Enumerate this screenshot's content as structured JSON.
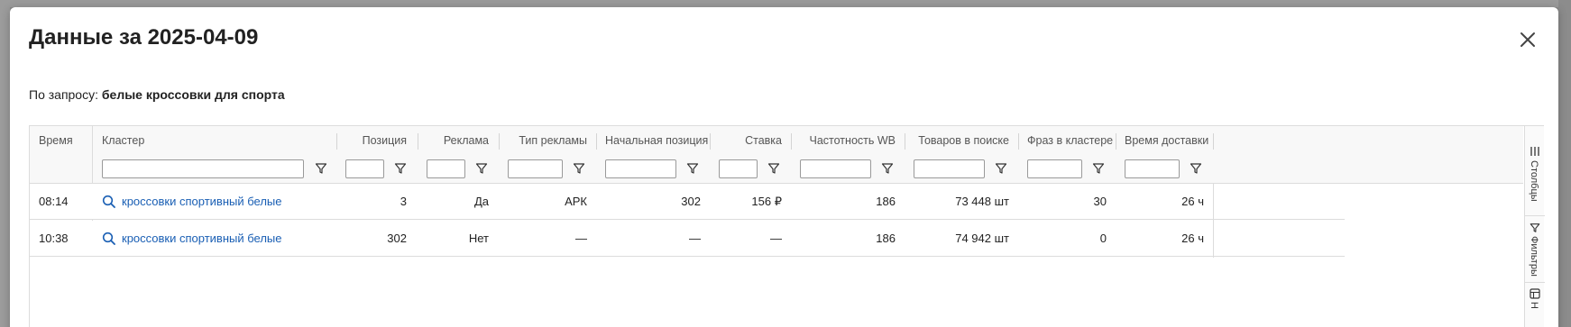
{
  "modal": {
    "title": "Данные за 2025-04-09",
    "query_label": "По запросу:",
    "query_value": "белые кроссовки для спорта"
  },
  "table": {
    "columns": [
      "Время",
      "Кластер",
      "Позиция",
      "Реклама",
      "Тип рекламы",
      "Начальная позиция",
      "Ставка",
      "Частотность WB",
      "Товаров в поиске",
      "Фраз в кластере",
      "Время доставки"
    ],
    "rows": [
      {
        "time": "08:14",
        "cluster": "кроссовки спортивный белые",
        "position": "3",
        "ad": "Да",
        "ad_type": "АРК",
        "start_position": "302",
        "bid": "156 ₽",
        "frequency": "186",
        "items_in_search": "73 448 шт",
        "phrases": "30",
        "delivery": "26 ч"
      },
      {
        "time": "10:38",
        "cluster": "кроссовки спортивный белые",
        "position": "302",
        "ad": "Нет",
        "ad_type": "—",
        "start_position": "—",
        "bid": "—",
        "frequency": "186",
        "items_in_search": "74 942 шт",
        "phrases": "0",
        "delivery": "26 ч"
      }
    ]
  },
  "side_panel": {
    "columns_tab": "Столбцы",
    "filters_tab": "Фильтры",
    "third_tab": "Н"
  },
  "icons": [
    "close-icon",
    "filter-icon",
    "search-icon",
    "columns-icon",
    "filter-panel-icon",
    "table-icon"
  ],
  "colors": {
    "link": "#1a5fb4"
  }
}
